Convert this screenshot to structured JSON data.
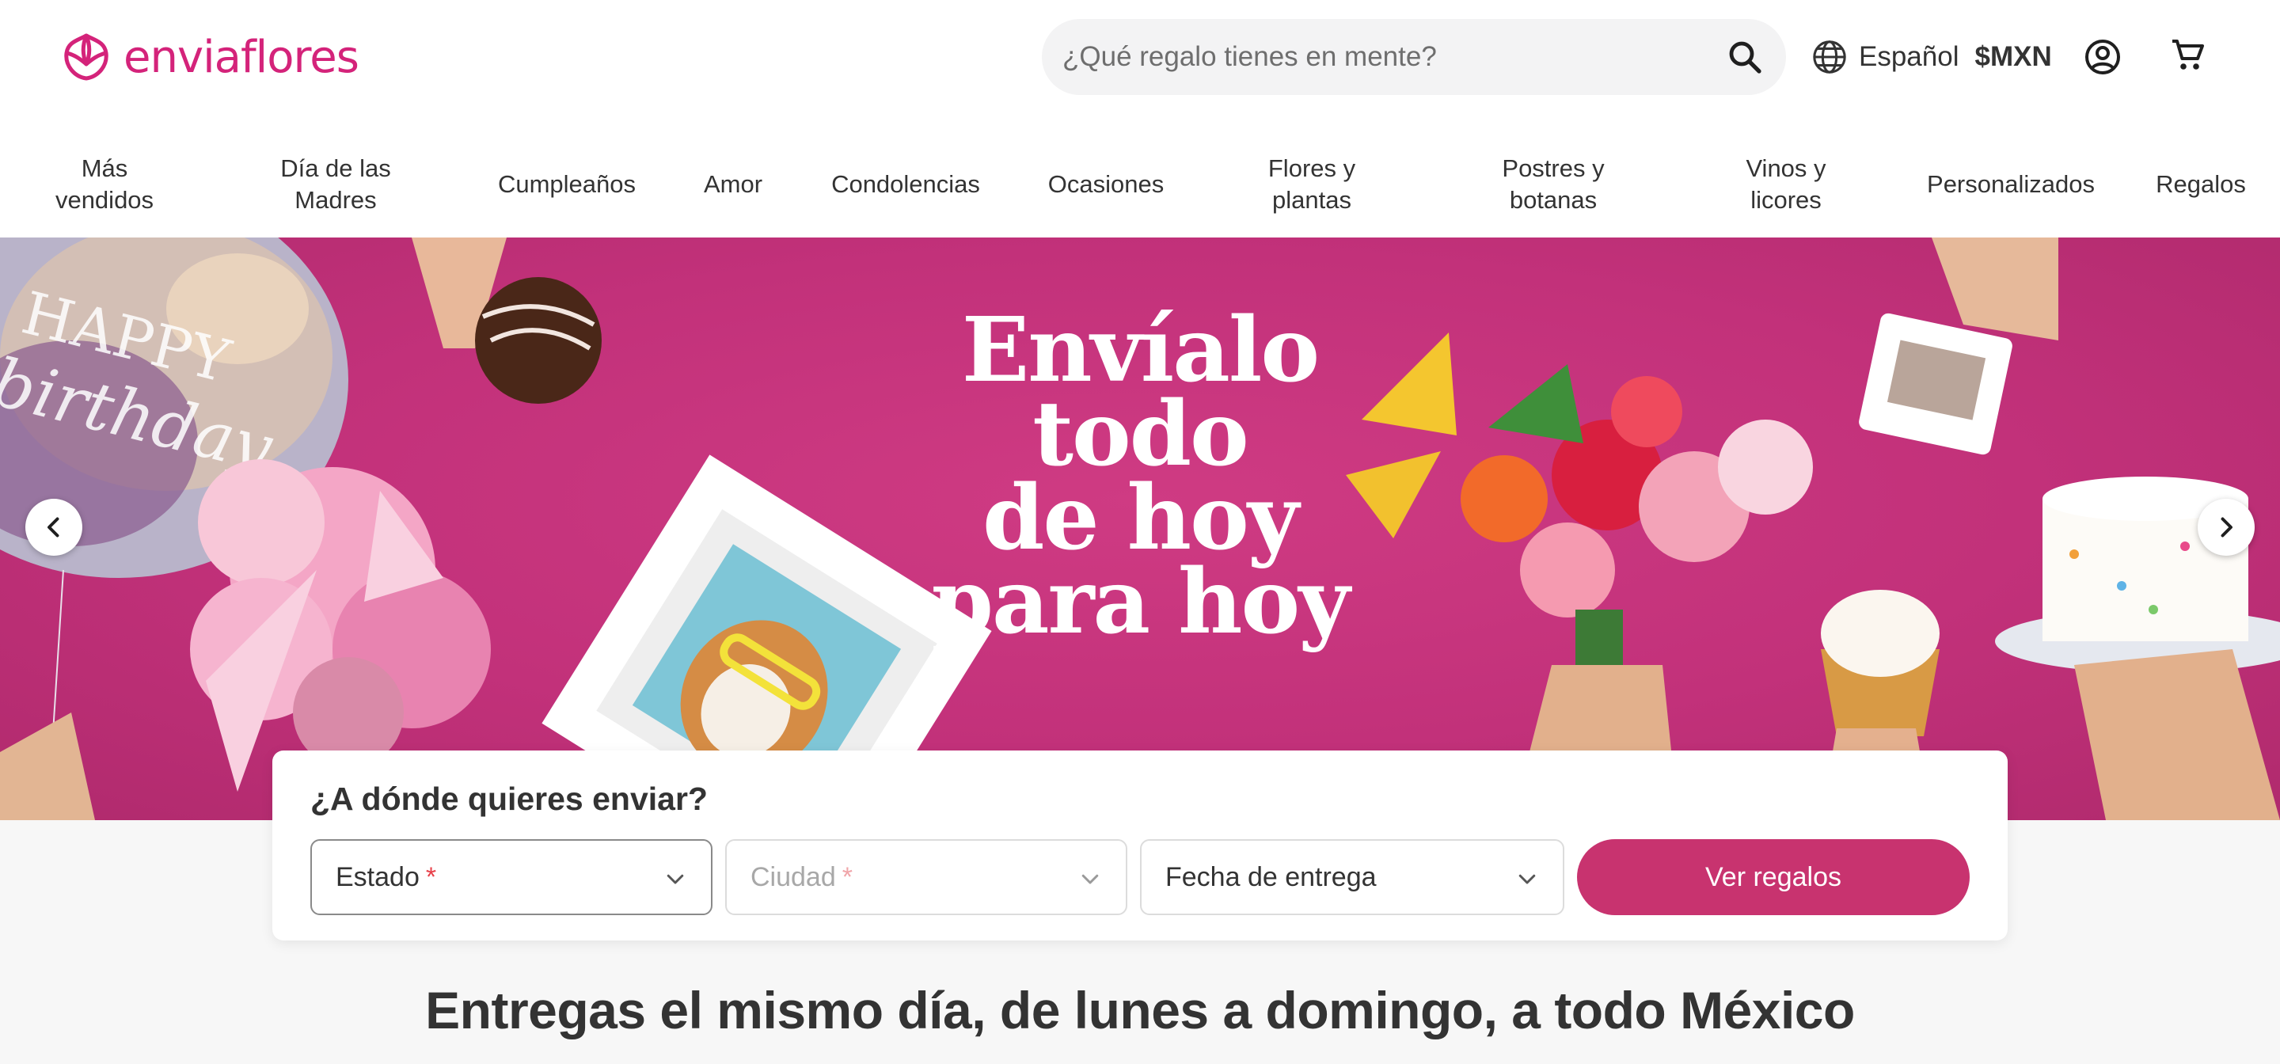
{
  "brand": {
    "name": "enviaflores",
    "color": "#d4237a"
  },
  "search": {
    "placeholder": "¿Qué regalo tienes en mente?",
    "icon": "search-icon"
  },
  "locale": {
    "language": "Español",
    "currency": "$MXN"
  },
  "nav": {
    "items": [
      {
        "label": "Más\nvendidos"
      },
      {
        "label": "Día de las\nMadres"
      },
      {
        "label": "Cumpleaños"
      },
      {
        "label": "Amor"
      },
      {
        "label": "Condolencias"
      },
      {
        "label": "Ocasiones"
      },
      {
        "label": "Flores y\nplantas"
      },
      {
        "label": "Postres y\nbotanas"
      },
      {
        "label": "Vinos y\nlicores"
      },
      {
        "label": "Personalizados"
      },
      {
        "label": "Regalos"
      }
    ]
  },
  "hero": {
    "headline": "Envíalo\ntodo\nde hoy\npara hoy",
    "background_color": "#c8337c",
    "balloon_text": "HAPPY birthday"
  },
  "finder": {
    "title": "¿A dónde quieres enviar?",
    "state": {
      "label": "Estado",
      "required_mark": "*"
    },
    "city": {
      "label": "Ciudad",
      "required_mark": "*"
    },
    "date": {
      "label": "Fecha de entrega"
    },
    "cta": "Ver regalos",
    "cta_color": "#c8336f"
  },
  "tagline": "Entregas el mismo día, de lunes a domingo, a todo México"
}
